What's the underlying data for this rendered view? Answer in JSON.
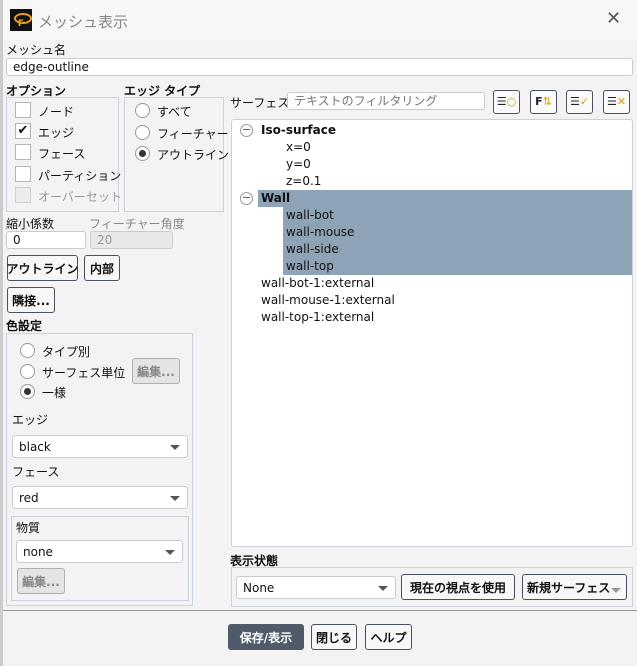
{
  "window": {
    "title": "メッシュ表示",
    "close_icon": "close-icon"
  },
  "mesh_name": {
    "label": "メッシュ名",
    "value": "edge-outline"
  },
  "options": {
    "label": "オプション",
    "items": [
      {
        "label": "ノード",
        "checked": false,
        "disabled": false
      },
      {
        "label": "エッジ",
        "checked": true,
        "disabled": false
      },
      {
        "label": "フェース",
        "checked": false,
        "disabled": false
      },
      {
        "label": "パーティション",
        "checked": false,
        "disabled": false
      },
      {
        "label": "オーバーセット",
        "checked": false,
        "disabled": true
      }
    ]
  },
  "edge_type": {
    "label": "エッジ タイプ",
    "items": [
      {
        "label": "すべて",
        "selected": false
      },
      {
        "label": "フィーチャー",
        "selected": false
      },
      {
        "label": "アウトライン",
        "selected": true
      }
    ]
  },
  "shrink": {
    "label": "縮小係数",
    "value": "0"
  },
  "feature_angle": {
    "label": "フィーチャー角度",
    "value": "20"
  },
  "buttons": {
    "outline": "アウトライン",
    "interior": "内部",
    "adjacency": "隣接..."
  },
  "color": {
    "label": "色設定",
    "options": [
      {
        "label": "タイプ別",
        "selected": false
      },
      {
        "label": "サーフェス単位",
        "selected": false
      },
      {
        "label": "一様",
        "selected": true
      }
    ],
    "edit": "編集...",
    "edge_label": "エッジ",
    "edge_value": "black",
    "face_label": "フェース",
    "face_value": "red",
    "material_label": "物質",
    "material_value": "none",
    "material_edit": "編集..."
  },
  "surfaces": {
    "label": "サーフェス",
    "filter_placeholder": "テキストのフィルタリング",
    "toolbar": [
      "filter-circle-icon",
      "filter-sort-icon",
      "select-all-icon",
      "deselect-all-icon"
    ],
    "tree": [
      {
        "label": "Iso-surface",
        "group": true,
        "selected": false,
        "children": [
          {
            "label": "x=0",
            "selected": false
          },
          {
            "label": "y=0",
            "selected": false
          },
          {
            "label": "z=0.1",
            "selected": false
          }
        ]
      },
      {
        "label": "Wall",
        "group": true,
        "selected": true,
        "children": [
          {
            "label": "wall-bot",
            "selected": true
          },
          {
            "label": "wall-mouse",
            "selected": true
          },
          {
            "label": "wall-side",
            "selected": true
          },
          {
            "label": "wall-top",
            "selected": true
          }
        ]
      }
    ],
    "loose": [
      "wall-bot-1:external",
      "wall-mouse-1:external",
      "wall-top-1:external"
    ]
  },
  "display_state": {
    "label": "表示状態",
    "value": "None",
    "use_view": "現在の視点を使用",
    "new_surface": "新規サーフェス"
  },
  "footer": {
    "save": "保存/表示",
    "close": "閉じる",
    "help": "ヘルプ"
  },
  "colors": {
    "accent": "#4f5b69",
    "selection": "#8fa3b6",
    "icon": "#d4a017"
  }
}
